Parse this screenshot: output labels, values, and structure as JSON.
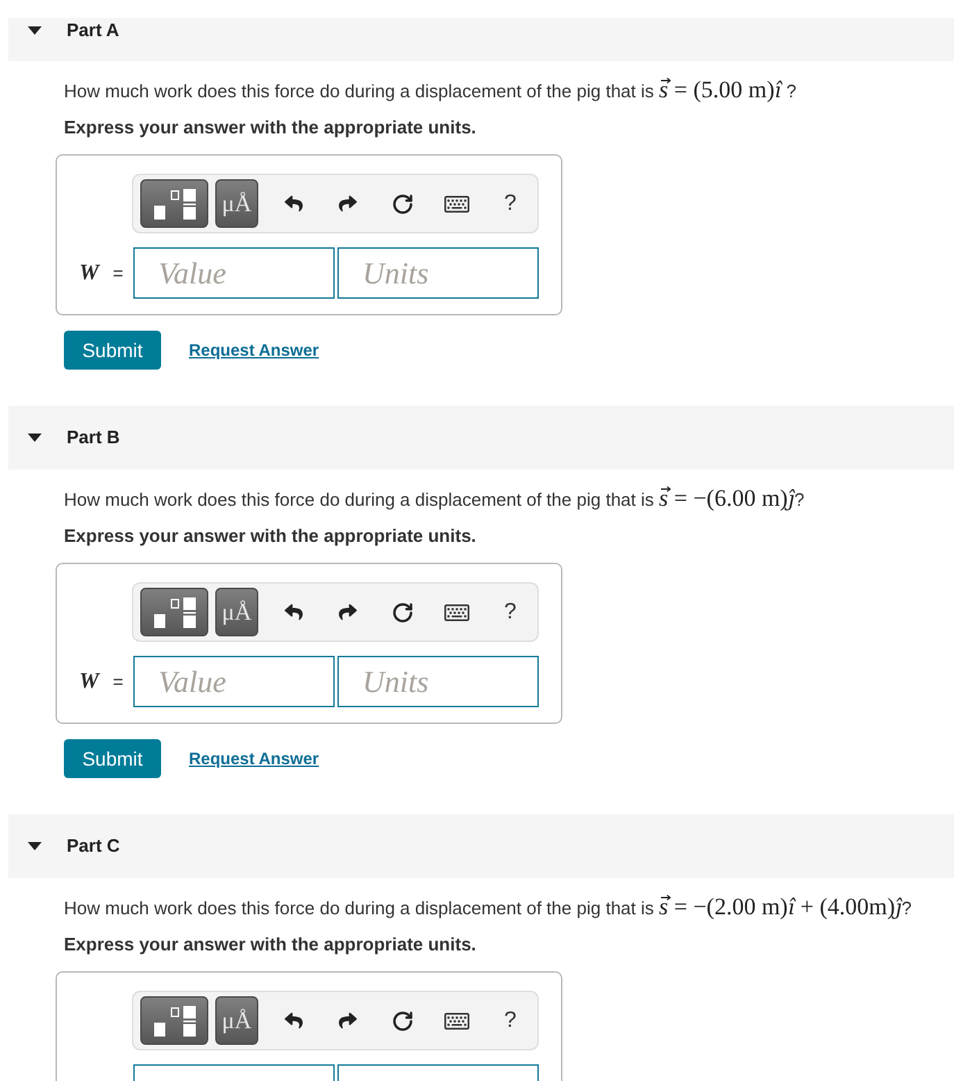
{
  "parts": [
    {
      "title": "Part A",
      "expanded": true,
      "question": [
        {
          "kind": "text",
          "text": "How much work does this force do during a displacement of the pig that is "
        },
        {
          "kind": "vector",
          "text": "s"
        },
        {
          "kind": "math",
          "text": " = (5.00 m)"
        },
        {
          "kind": "unit_vector",
          "text": "ı̂"
        },
        {
          "kind": "text",
          "text": " ?"
        }
      ],
      "instruction": "Express your answer with the appropriate units.",
      "toolbar": [
        {
          "kind": "templates"
        },
        {
          "kind": "units",
          "label": "μÅ"
        },
        {
          "kind": "undo"
        },
        {
          "kind": "redo"
        },
        {
          "kind": "reset"
        },
        {
          "kind": "keyboard"
        },
        {
          "kind": "help",
          "label": "?"
        }
      ],
      "answer": {
        "variable": "W",
        "relation": "=",
        "value_placeholder": "Value",
        "units_placeholder": "Units"
      },
      "actions": {
        "submit": "Submit",
        "request": "Request Answer"
      }
    },
    {
      "title": "Part B",
      "expanded": true,
      "question": [
        {
          "kind": "text",
          "text": "How much work does this force do during a displacement of the pig that is "
        },
        {
          "kind": "vector",
          "text": "s"
        },
        {
          "kind": "math",
          "text": " = −(6.00 m)"
        },
        {
          "kind": "unit_vector",
          "text": "ȷ̂"
        },
        {
          "kind": "text",
          "text": "?"
        }
      ],
      "instruction": "Express your answer with the appropriate units.",
      "toolbar": [
        {
          "kind": "templates"
        },
        {
          "kind": "units",
          "label": "μÅ"
        },
        {
          "kind": "undo"
        },
        {
          "kind": "redo"
        },
        {
          "kind": "reset"
        },
        {
          "kind": "keyboard"
        },
        {
          "kind": "help",
          "label": "?"
        }
      ],
      "answer": {
        "variable": "W",
        "relation": "=",
        "value_placeholder": "Value",
        "units_placeholder": "Units"
      },
      "actions": {
        "submit": "Submit",
        "request": "Request Answer"
      }
    },
    {
      "title": "Part C",
      "expanded": true,
      "question": [
        {
          "kind": "text",
          "text": "How much work does this force do during a displacement of the pig that is "
        },
        {
          "kind": "vector",
          "text": "s"
        },
        {
          "kind": "math",
          "text": " = −(2.00 m)"
        },
        {
          "kind": "unit_vector",
          "text": "ı̂"
        },
        {
          "kind": "math",
          "text": " + (4.00m)"
        },
        {
          "kind": "unit_vector",
          "text": "ȷ̂"
        },
        {
          "kind": "text",
          "text": "?"
        }
      ],
      "instruction": "Express your answer with the appropriate units.",
      "toolbar": [
        {
          "kind": "templates"
        },
        {
          "kind": "units",
          "label": "μÅ"
        },
        {
          "kind": "undo"
        },
        {
          "kind": "redo"
        },
        {
          "kind": "reset"
        },
        {
          "kind": "keyboard"
        },
        {
          "kind": "help",
          "label": "?"
        }
      ]
    }
  ]
}
